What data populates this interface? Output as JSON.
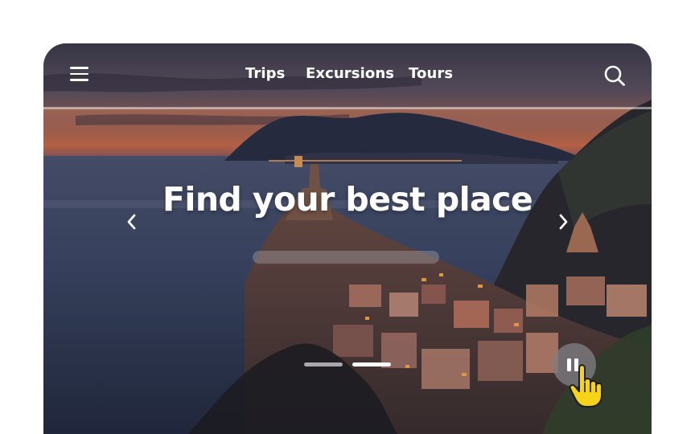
{
  "nav": {
    "items": [
      {
        "label": "Trips"
      },
      {
        "label": "Excursions"
      },
      {
        "label": "Tours"
      }
    ]
  },
  "hero": {
    "headline": "Find your best place"
  },
  "carousel": {
    "slide_count": 2,
    "active_slide": 2,
    "state": "playing"
  },
  "icons": {
    "menu": "hamburger-menu-icon",
    "search": "magnifier-search-icon",
    "prev": "chevron-left-icon",
    "next": "chevron-right-icon",
    "pause": "pause-icon",
    "cursor": "hand-pointer-cursor-icon"
  },
  "colors": {
    "text": "#ffffff",
    "dot_active": "#ffffff",
    "dot_inactive": "#a8a8ad",
    "pause_bg": "#7d7d82",
    "cursor_fill": "#f5d318"
  }
}
